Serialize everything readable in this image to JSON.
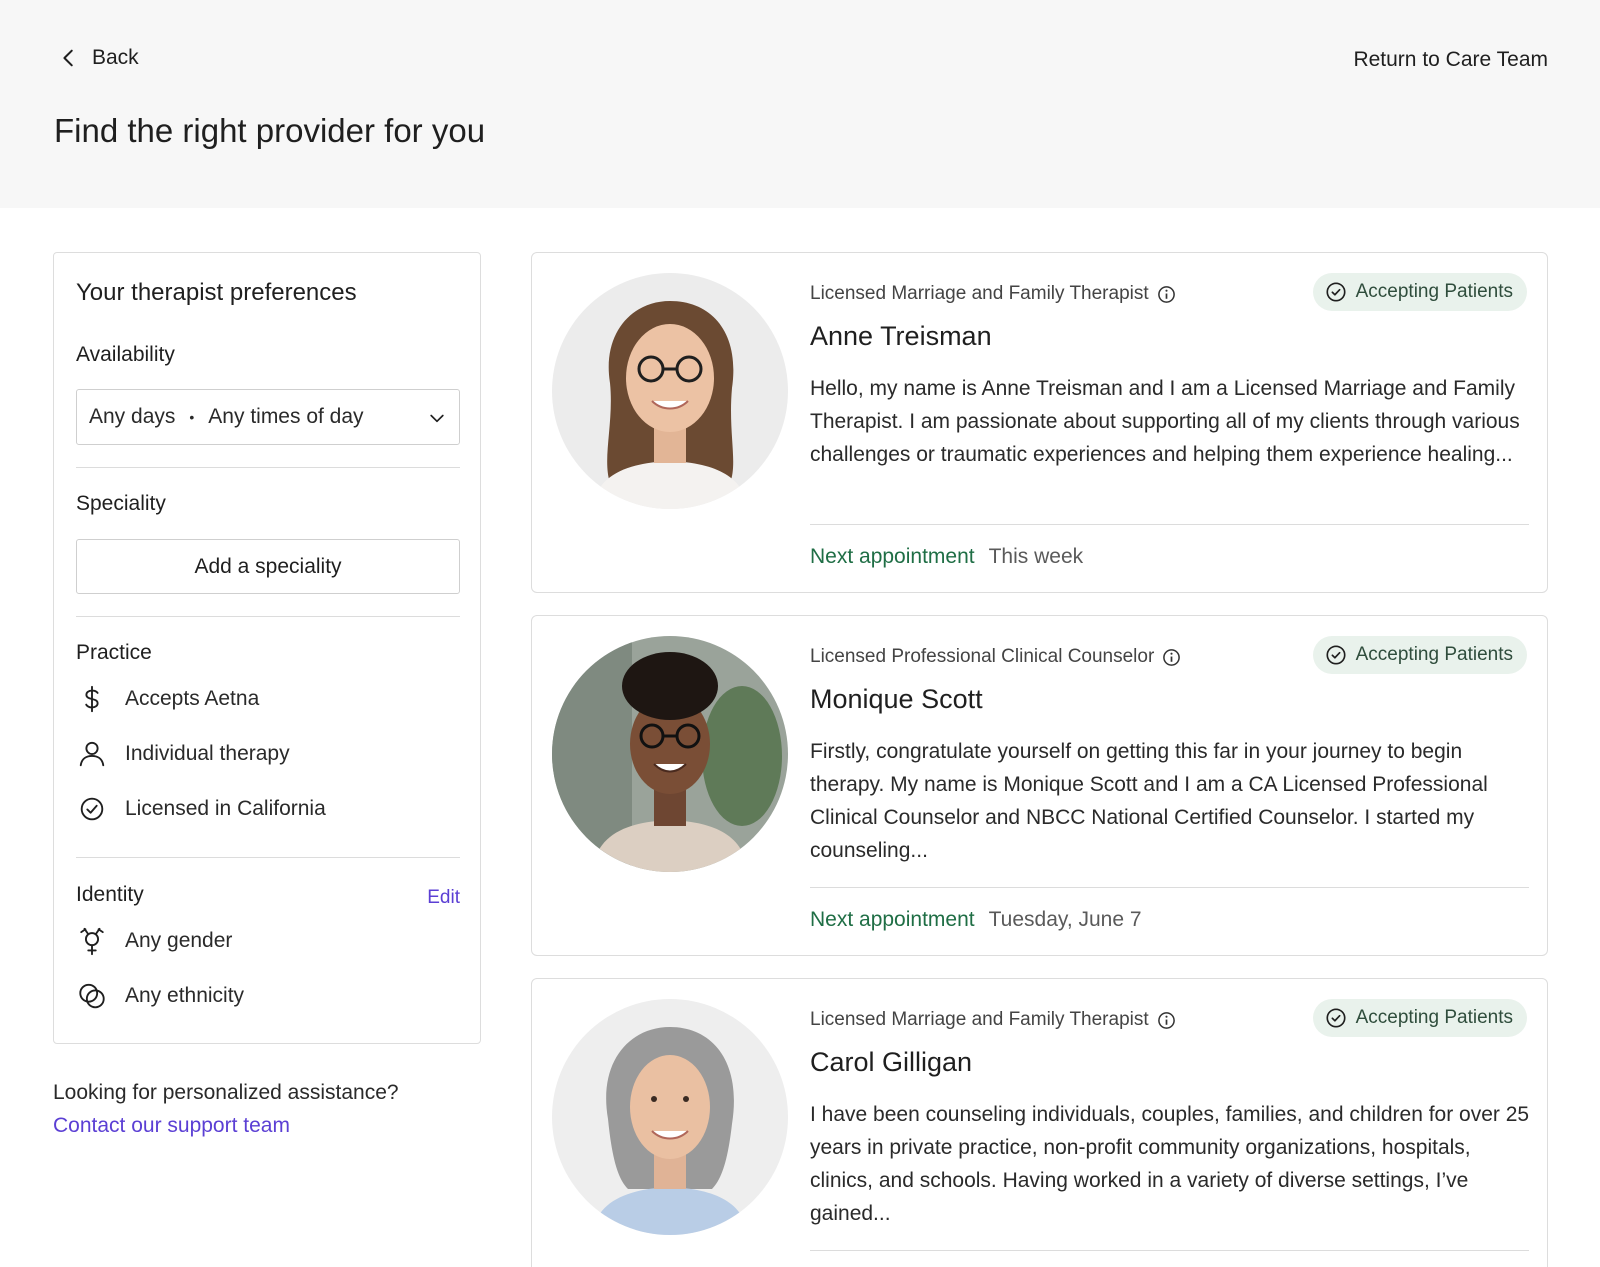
{
  "header": {
    "back_label": "Back",
    "return_label": "Return to Care Team",
    "title": "Find the right provider for you"
  },
  "sidebar": {
    "title": "Your therapist preferences",
    "availability": {
      "heading": "Availability",
      "days": "Any days",
      "separator": "•",
      "times": "Any times of day"
    },
    "speciality": {
      "heading": "Speciality",
      "button": "Add a speciality"
    },
    "practice": {
      "heading": "Practice",
      "items": [
        {
          "icon": "dollar-icon",
          "label": "Accepts Aetna"
        },
        {
          "icon": "person-icon",
          "label": "Individual therapy"
        },
        {
          "icon": "check-circle-icon",
          "label": "Licensed in California"
        }
      ]
    },
    "identity": {
      "heading": "Identity",
      "edit_label": "Edit",
      "items": [
        {
          "icon": "gender-icon",
          "label": "Any gender"
        },
        {
          "icon": "ethnicity-icon",
          "label": "Any ethnicity"
        }
      ]
    }
  },
  "help": {
    "text": "Looking for personalized assistance?",
    "link": "Contact our support team"
  },
  "providers": [
    {
      "credential": "Licensed Marriage and Family Therapist",
      "badge": "Accepting Patients",
      "name": "Anne Treisman",
      "bio": "Hello, my name is Anne Treisman and I am a Licensed Marriage and Family Therapist. I am passionate about supporting all of my clients through various challenges or traumatic experiences and helping them experience healing...",
      "next_label": "Next appointment",
      "next_value": "This week"
    },
    {
      "credential": "Licensed Professional Clinical Counselor",
      "badge": "Accepting Patients",
      "name": "Monique Scott",
      "bio": "Firstly, congratulate yourself on getting this far in your journey to begin therapy. My name is Monique Scott and I am a CA Licensed Professional Clinical Counselor and NBCC National Certified Counselor. I started my counseling...",
      "next_label": "Next appointment",
      "next_value": "Tuesday, June 7"
    },
    {
      "credential": "Licensed Marriage and Family Therapist",
      "badge": "Accepting Patients",
      "name": "Carol Gilligan",
      "bio": "I have been counseling individuals, couples, families, and children for over 25 years in private practice, non-profit community organizations, hospitals, clinics, and schools. Having worked in a variety of diverse settings, I’ve gained..."
    }
  ],
  "colors": {
    "accent_link": "#5b3fd4",
    "next_appointment": "#1f6e45",
    "badge_bg": "#e9f2ec",
    "header_bg": "#f7f7f7"
  }
}
